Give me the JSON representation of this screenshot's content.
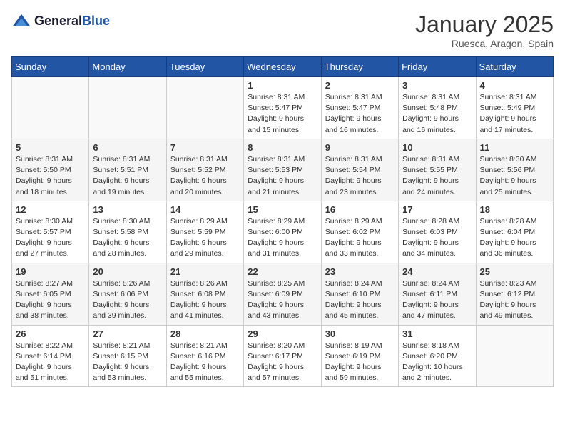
{
  "logo": {
    "general": "General",
    "blue": "Blue"
  },
  "header": {
    "month": "January 2025",
    "location": "Ruesca, Aragon, Spain"
  },
  "weekdays": [
    "Sunday",
    "Monday",
    "Tuesday",
    "Wednesday",
    "Thursday",
    "Friday",
    "Saturday"
  ],
  "weeks": [
    [
      {
        "day": "",
        "info": ""
      },
      {
        "day": "",
        "info": ""
      },
      {
        "day": "",
        "info": ""
      },
      {
        "day": "1",
        "info": "Sunrise: 8:31 AM\nSunset: 5:47 PM\nDaylight: 9 hours\nand 15 minutes."
      },
      {
        "day": "2",
        "info": "Sunrise: 8:31 AM\nSunset: 5:47 PM\nDaylight: 9 hours\nand 16 minutes."
      },
      {
        "day": "3",
        "info": "Sunrise: 8:31 AM\nSunset: 5:48 PM\nDaylight: 9 hours\nand 16 minutes."
      },
      {
        "day": "4",
        "info": "Sunrise: 8:31 AM\nSunset: 5:49 PM\nDaylight: 9 hours\nand 17 minutes."
      }
    ],
    [
      {
        "day": "5",
        "info": "Sunrise: 8:31 AM\nSunset: 5:50 PM\nDaylight: 9 hours\nand 18 minutes."
      },
      {
        "day": "6",
        "info": "Sunrise: 8:31 AM\nSunset: 5:51 PM\nDaylight: 9 hours\nand 19 minutes."
      },
      {
        "day": "7",
        "info": "Sunrise: 8:31 AM\nSunset: 5:52 PM\nDaylight: 9 hours\nand 20 minutes."
      },
      {
        "day": "8",
        "info": "Sunrise: 8:31 AM\nSunset: 5:53 PM\nDaylight: 9 hours\nand 21 minutes."
      },
      {
        "day": "9",
        "info": "Sunrise: 8:31 AM\nSunset: 5:54 PM\nDaylight: 9 hours\nand 23 minutes."
      },
      {
        "day": "10",
        "info": "Sunrise: 8:31 AM\nSunset: 5:55 PM\nDaylight: 9 hours\nand 24 minutes."
      },
      {
        "day": "11",
        "info": "Sunrise: 8:30 AM\nSunset: 5:56 PM\nDaylight: 9 hours\nand 25 minutes."
      }
    ],
    [
      {
        "day": "12",
        "info": "Sunrise: 8:30 AM\nSunset: 5:57 PM\nDaylight: 9 hours\nand 27 minutes."
      },
      {
        "day": "13",
        "info": "Sunrise: 8:30 AM\nSunset: 5:58 PM\nDaylight: 9 hours\nand 28 minutes."
      },
      {
        "day": "14",
        "info": "Sunrise: 8:29 AM\nSunset: 5:59 PM\nDaylight: 9 hours\nand 29 minutes."
      },
      {
        "day": "15",
        "info": "Sunrise: 8:29 AM\nSunset: 6:00 PM\nDaylight: 9 hours\nand 31 minutes."
      },
      {
        "day": "16",
        "info": "Sunrise: 8:29 AM\nSunset: 6:02 PM\nDaylight: 9 hours\nand 33 minutes."
      },
      {
        "day": "17",
        "info": "Sunrise: 8:28 AM\nSunset: 6:03 PM\nDaylight: 9 hours\nand 34 minutes."
      },
      {
        "day": "18",
        "info": "Sunrise: 8:28 AM\nSunset: 6:04 PM\nDaylight: 9 hours\nand 36 minutes."
      }
    ],
    [
      {
        "day": "19",
        "info": "Sunrise: 8:27 AM\nSunset: 6:05 PM\nDaylight: 9 hours\nand 38 minutes."
      },
      {
        "day": "20",
        "info": "Sunrise: 8:26 AM\nSunset: 6:06 PM\nDaylight: 9 hours\nand 39 minutes."
      },
      {
        "day": "21",
        "info": "Sunrise: 8:26 AM\nSunset: 6:08 PM\nDaylight: 9 hours\nand 41 minutes."
      },
      {
        "day": "22",
        "info": "Sunrise: 8:25 AM\nSunset: 6:09 PM\nDaylight: 9 hours\nand 43 minutes."
      },
      {
        "day": "23",
        "info": "Sunrise: 8:24 AM\nSunset: 6:10 PM\nDaylight: 9 hours\nand 45 minutes."
      },
      {
        "day": "24",
        "info": "Sunrise: 8:24 AM\nSunset: 6:11 PM\nDaylight: 9 hours\nand 47 minutes."
      },
      {
        "day": "25",
        "info": "Sunrise: 8:23 AM\nSunset: 6:12 PM\nDaylight: 9 hours\nand 49 minutes."
      }
    ],
    [
      {
        "day": "26",
        "info": "Sunrise: 8:22 AM\nSunset: 6:14 PM\nDaylight: 9 hours\nand 51 minutes."
      },
      {
        "day": "27",
        "info": "Sunrise: 8:21 AM\nSunset: 6:15 PM\nDaylight: 9 hours\nand 53 minutes."
      },
      {
        "day": "28",
        "info": "Sunrise: 8:21 AM\nSunset: 6:16 PM\nDaylight: 9 hours\nand 55 minutes."
      },
      {
        "day": "29",
        "info": "Sunrise: 8:20 AM\nSunset: 6:17 PM\nDaylight: 9 hours\nand 57 minutes."
      },
      {
        "day": "30",
        "info": "Sunrise: 8:19 AM\nSunset: 6:19 PM\nDaylight: 9 hours\nand 59 minutes."
      },
      {
        "day": "31",
        "info": "Sunrise: 8:18 AM\nSunset: 6:20 PM\nDaylight: 10 hours\nand 2 minutes."
      },
      {
        "day": "",
        "info": ""
      }
    ]
  ]
}
